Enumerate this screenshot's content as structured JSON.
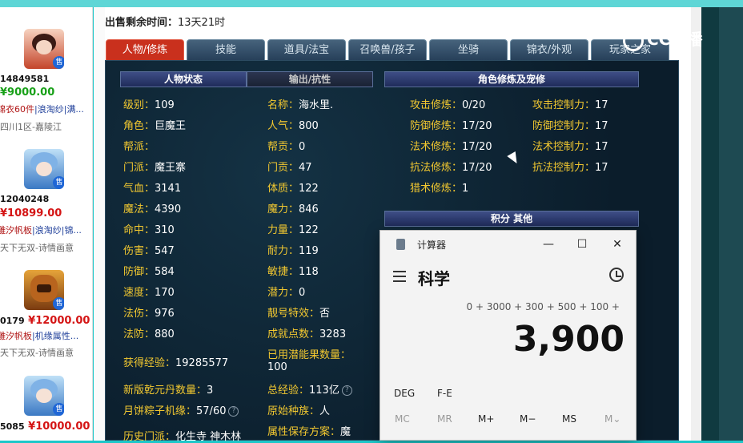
{
  "sidebar": {
    "listings": [
      {
        "id": "14849581",
        "price": "¥9000.00",
        "price_color": "#18a018",
        "tags": [
          "锦衣60件",
          "浪淘纱",
          "满..."
        ],
        "server": "四川1区-嘉陵江",
        "badge": "售"
      },
      {
        "id": "12040248",
        "price": "¥10899.00",
        "price_color": "#d41414",
        "tags": [
          "雕汐帆板",
          "浪淘纱",
          "锦..."
        ],
        "server": "天下无双-诗情画意",
        "badge": "售"
      },
      {
        "id": "0179",
        "price": "¥12000.00",
        "price_color": "#d41414",
        "tags": [
          "雕汐帆板",
          "机缘属性..."
        ],
        "server": "天下无双-诗情画意",
        "badge": "售"
      },
      {
        "id": "5085",
        "price": "¥10000.00",
        "price_color": "#d41414",
        "tags": [],
        "server": "",
        "badge": "售"
      }
    ]
  },
  "sale_time": {
    "label": "出售剩余时间：",
    "value": "13天21时"
  },
  "tabs": [
    "人物/修炼",
    "技能",
    "道具/法宝",
    "召唤兽/孩子",
    "坐骑",
    "锦衣/外观",
    "玩家之家"
  ],
  "subheaders": {
    "status": "人物状态",
    "output": "输出/抗性",
    "cultivation": "角色修炼及宠修",
    "score": "积分 其他"
  },
  "attrs_left": [
    {
      "k": "级别：",
      "v": "109"
    },
    {
      "k": "角色：",
      "v": "巨魔王"
    },
    {
      "k": "帮派：",
      "v": ""
    },
    {
      "k": "门派：",
      "v": "魔王寨"
    },
    {
      "k": "气血：",
      "v": "3141"
    },
    {
      "k": "魔法：",
      "v": "4390"
    },
    {
      "k": "命中：",
      "v": "310"
    },
    {
      "k": "伤害：",
      "v": "547"
    },
    {
      "k": "防御：",
      "v": "584"
    },
    {
      "k": "速度：",
      "v": "170"
    },
    {
      "k": "法伤：",
      "v": "976"
    },
    {
      "k": "法防：",
      "v": "880"
    }
  ],
  "attrs_mid": [
    {
      "k": "名称：",
      "v": "海水里."
    },
    {
      "k": "人气：",
      "v": "800"
    },
    {
      "k": "帮贡：",
      "v": "0"
    },
    {
      "k": "门贡：",
      "v": "47"
    },
    {
      "k": "体质：",
      "v": "122"
    },
    {
      "k": "魔力：",
      "v": "846"
    },
    {
      "k": "力量：",
      "v": "122"
    },
    {
      "k": "耐力：",
      "v": "119"
    },
    {
      "k": "敏捷：",
      "v": "118"
    },
    {
      "k": "潜力：",
      "v": "0"
    },
    {
      "k": "靓号特效：",
      "v": "否"
    },
    {
      "k": "成就点数：",
      "v": "3283"
    }
  ],
  "attrs_bottom": {
    "exp": {
      "k": "获得经验：",
      "v": "19285577"
    },
    "potion": {
      "k": "已用潜能果数量：",
      "v": "100"
    },
    "dan": {
      "k": "新版乾元丹数量：",
      "v": "3"
    },
    "total_exp": {
      "k": "总经验：",
      "v": "113亿"
    },
    "mooncake": {
      "k": "月饼粽子机缘：",
      "v": "57/60"
    },
    "race": {
      "k": "原始种族：",
      "v": "人"
    },
    "history": {
      "k": "历史门派：",
      "v": "化生寺 神木林"
    },
    "save": {
      "k": "属性保存方案：",
      "v": "魔"
    }
  },
  "cultivation": [
    {
      "k": "攻击修炼：",
      "v": "0/20",
      "k2": "攻击控制力：",
      "v2": "17"
    },
    {
      "k": "防御修炼：",
      "v": "17/20",
      "k2": "防御控制力：",
      "v2": "17"
    },
    {
      "k": "法术修炼：",
      "v": "17/20",
      "k2": "法术控制力：",
      "v2": "17"
    },
    {
      "k": "抗法修炼：",
      "v": "17/20",
      "k2": "抗法控制力：",
      "v2": "17"
    },
    {
      "k": "猎术修炼：",
      "v": "1",
      "k2": "",
      "v2": ""
    }
  ],
  "logo": "CC直播",
  "calculator": {
    "app_name": "计算器",
    "mode": "科学",
    "expression": "0 + 3000 + 300 + 500 + 100 +",
    "result": "3,900",
    "row1": [
      "DEG",
      "F-E"
    ],
    "memory": [
      "MC",
      "MR",
      "M+",
      "M−",
      "MS",
      "M⌄"
    ],
    "minimize": "—",
    "maximize": "☐",
    "close": "✕"
  },
  "help_icon": "?"
}
